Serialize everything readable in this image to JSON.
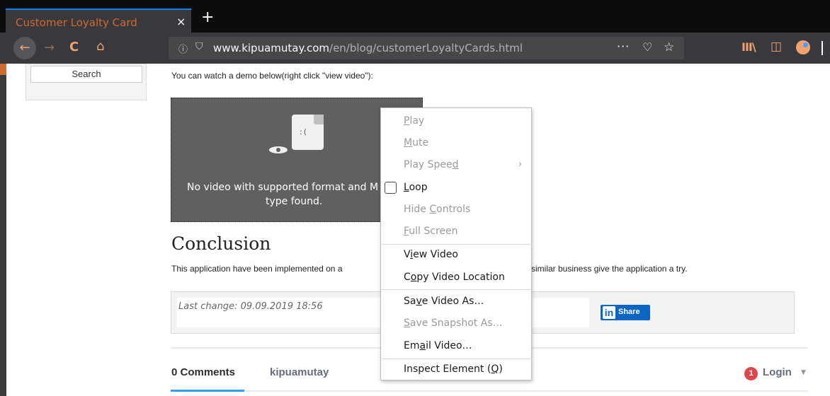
{
  "browser": {
    "tab_title": "Customer Loyalty Card",
    "tab_close": "×",
    "new_tab": "+",
    "icons": {
      "back": "←",
      "forward": "→",
      "reload": "C",
      "home": "⌂",
      "info": "ⓘ",
      "shield": "⛉",
      "more": "···",
      "pocket": "♡",
      "star": "☆",
      "library": "III\\",
      "sidebar": "◫"
    },
    "url_domain": "www.kipuamutay.com",
    "url_path": "/en/blog/customerLoyaltyCards.html"
  },
  "page": {
    "search_label": "Search",
    "intro_text": "You can watch a demo below(right click \"view video\"):",
    "video_error_line1": "No video with supported format and M",
    "video_error_line2": "type found.",
    "video_face": ":(",
    "conclusion_heading": "Conclusion",
    "conclusion_text_a": "This application have been implemented on a",
    "conclusion_text_b": "similar business give the application a try.",
    "last_change": "Last change: 09.09.2019 18:56",
    "share_in": "in",
    "share_label": "Share",
    "comments_count": "0 Comments",
    "comments_site": "kipuamutay",
    "login_badge": "1",
    "login_label": "Login",
    "login_caret": "▼"
  },
  "context_menu": {
    "play": {
      "pre": "",
      "u": "P",
      "post": "lay"
    },
    "mute": {
      "pre": "",
      "u": "M",
      "post": "ute"
    },
    "play_speed": {
      "pre": "Play Spee",
      "u": "d",
      "post": ""
    },
    "play_speed_arrow": "›",
    "loop": {
      "pre": "",
      "u": "L",
      "post": "oop"
    },
    "hide_controls": {
      "pre": "Hide ",
      "u": "C",
      "post": "ontrols"
    },
    "full_screen": {
      "pre": "",
      "u": "F",
      "post": "ull Screen"
    },
    "view_video": {
      "pre": "V",
      "u": "i",
      "post": "ew Video"
    },
    "copy_video_location": {
      "pre": "C",
      "u": "o",
      "post": "py Video Location"
    },
    "save_video_as": {
      "pre": "Sa",
      "u": "v",
      "post": "e Video As…"
    },
    "save_snapshot_as": {
      "pre": "",
      "u": "S",
      "post": "ave Snapshot As…"
    },
    "email_video": {
      "pre": "Em",
      "u": "a",
      "post": "il Video…"
    },
    "inspect_element": {
      "pre": "Inspect Element (",
      "u": "Q",
      "post": ")"
    }
  },
  "colors": {
    "tab_accent": "#0a84ff",
    "toolbar_icon": "#f0a36f",
    "linkedin_blue": "#0a66c2",
    "disqus_badge": "#e0474c",
    "disqus_tab_underline": "#2e9fff"
  }
}
